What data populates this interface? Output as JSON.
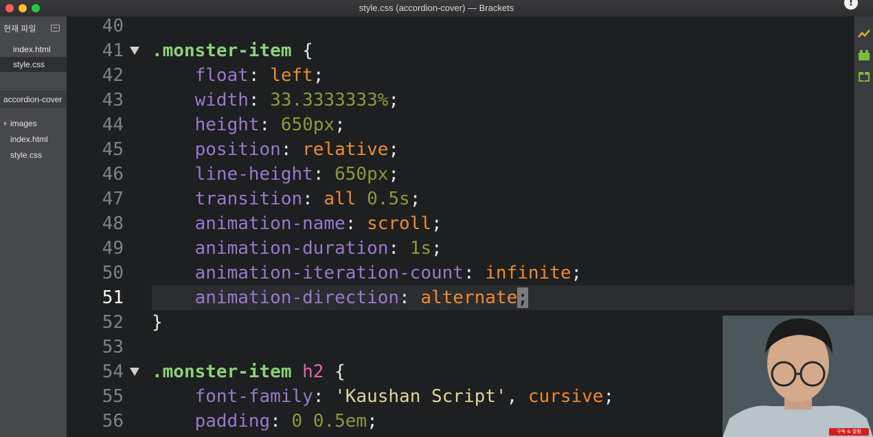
{
  "window": {
    "title": "style.css (accordion-cover) — Brackets",
    "badge": "!"
  },
  "sidebar": {
    "header": "현재 파일",
    "working_files": [
      {
        "name": "index.html",
        "active": false
      },
      {
        "name": "style.css",
        "active": true
      }
    ],
    "project": "accordion-cover",
    "tree": [
      {
        "name": "images",
        "is_folder": true
      },
      {
        "name": "index.html",
        "is_folder": false
      },
      {
        "name": "style.css",
        "is_folder": false
      }
    ]
  },
  "editor": {
    "current_line": 51,
    "line_numbers": [
      "40",
      "41",
      "42",
      "43",
      "44",
      "45",
      "46",
      "47",
      "48",
      "49",
      "50",
      "51",
      "52",
      "53",
      "54",
      "55",
      "56"
    ],
    "folds": [
      "41",
      "54"
    ],
    "lines": [
      {
        "n": "40",
        "tokens": []
      },
      {
        "n": "41",
        "tokens": [
          {
            "t": ".monster-item",
            "c": "sel"
          },
          {
            "t": " {",
            "c": "brace"
          }
        ]
      },
      {
        "n": "42",
        "tokens": [
          {
            "t": "    float",
            "c": "prop"
          },
          {
            "t": ": ",
            "c": "colon"
          },
          {
            "t": "left",
            "c": "kw"
          },
          {
            "t": ";",
            "c": "semi"
          }
        ]
      },
      {
        "n": "43",
        "tokens": [
          {
            "t": "    width",
            "c": "prop"
          },
          {
            "t": ": ",
            "c": "colon"
          },
          {
            "t": "33.3333333%",
            "c": "num"
          },
          {
            "t": ";",
            "c": "semi"
          }
        ]
      },
      {
        "n": "44",
        "tokens": [
          {
            "t": "    height",
            "c": "prop"
          },
          {
            "t": ": ",
            "c": "colon"
          },
          {
            "t": "650px",
            "c": "num"
          },
          {
            "t": ";",
            "c": "semi"
          }
        ]
      },
      {
        "n": "45",
        "tokens": [
          {
            "t": "    position",
            "c": "prop"
          },
          {
            "t": ": ",
            "c": "colon"
          },
          {
            "t": "relative",
            "c": "kw"
          },
          {
            "t": ";",
            "c": "semi"
          }
        ]
      },
      {
        "n": "46",
        "tokens": [
          {
            "t": "    line-height",
            "c": "prop"
          },
          {
            "t": ": ",
            "c": "colon"
          },
          {
            "t": "650px",
            "c": "num"
          },
          {
            "t": ";",
            "c": "semi"
          }
        ]
      },
      {
        "n": "47",
        "tokens": [
          {
            "t": "    transition",
            "c": "prop"
          },
          {
            "t": ": ",
            "c": "colon"
          },
          {
            "t": "all",
            "c": "kw"
          },
          {
            "t": " ",
            "c": "colon"
          },
          {
            "t": "0.5s",
            "c": "num"
          },
          {
            "t": ";",
            "c": "semi"
          }
        ]
      },
      {
        "n": "48",
        "tokens": [
          {
            "t": "    animation-name",
            "c": "prop"
          },
          {
            "t": ": ",
            "c": "colon"
          },
          {
            "t": "scroll",
            "c": "kw"
          },
          {
            "t": ";",
            "c": "semi"
          }
        ]
      },
      {
        "n": "49",
        "tokens": [
          {
            "t": "    animation-duration",
            "c": "prop"
          },
          {
            "t": ": ",
            "c": "colon"
          },
          {
            "t": "1s",
            "c": "num"
          },
          {
            "t": ";",
            "c": "semi"
          }
        ]
      },
      {
        "n": "50",
        "tokens": [
          {
            "t": "    animation-iteration-count",
            "c": "prop"
          },
          {
            "t": ": ",
            "c": "colon"
          },
          {
            "t": "infinite",
            "c": "kw"
          },
          {
            "t": ";",
            "c": "semi"
          }
        ]
      },
      {
        "n": "51",
        "tokens": [
          {
            "t": "    animation-direction",
            "c": "prop"
          },
          {
            "t": ": ",
            "c": "colon"
          },
          {
            "t": "alternate",
            "c": "kw"
          },
          {
            "t": ";",
            "c": "cursor"
          }
        ]
      },
      {
        "n": "52",
        "tokens": [
          {
            "t": "}",
            "c": "brace"
          }
        ]
      },
      {
        "n": "53",
        "tokens": []
      },
      {
        "n": "54",
        "tokens": [
          {
            "t": ".monster-item",
            "c": "sel"
          },
          {
            "t": " ",
            "c": "brace"
          },
          {
            "t": "h2",
            "c": "tag"
          },
          {
            "t": " {",
            "c": "brace"
          }
        ]
      },
      {
        "n": "55",
        "tokens": [
          {
            "t": "    font-family",
            "c": "prop"
          },
          {
            "t": ": ",
            "c": "colon"
          },
          {
            "t": "'Kaushan Script'",
            "c": "str"
          },
          {
            "t": ", ",
            "c": "colon"
          },
          {
            "t": "cursive",
            "c": "kw"
          },
          {
            "t": ";",
            "c": "semi"
          }
        ]
      },
      {
        "n": "56",
        "tokens": [
          {
            "t": "    padding",
            "c": "prop"
          },
          {
            "t": ": ",
            "c": "colon"
          },
          {
            "t": "0",
            "c": "num"
          },
          {
            "t": " ",
            "c": "colon"
          },
          {
            "t": "0.5em",
            "c": "num"
          },
          {
            "t": ";",
            "c": "semi"
          }
        ]
      }
    ]
  },
  "right_toolbar": {
    "icons": [
      "live-preview-icon",
      "extension-manager-icon",
      "gift-icon"
    ],
    "colors": {
      "live": "#e8b13c",
      "ext": "#7dbb3a",
      "gift": "#7dbb3a"
    }
  },
  "overlay": {
    "webcam_badge": "구독 & 알림"
  },
  "colors": {
    "editor_bg": "#1d1f21",
    "sidebar_bg": "#47484b",
    "selector": "#8bd17a",
    "property": "#9a79c9",
    "keyword": "#ef8b30",
    "number": "#8d9a3a"
  }
}
